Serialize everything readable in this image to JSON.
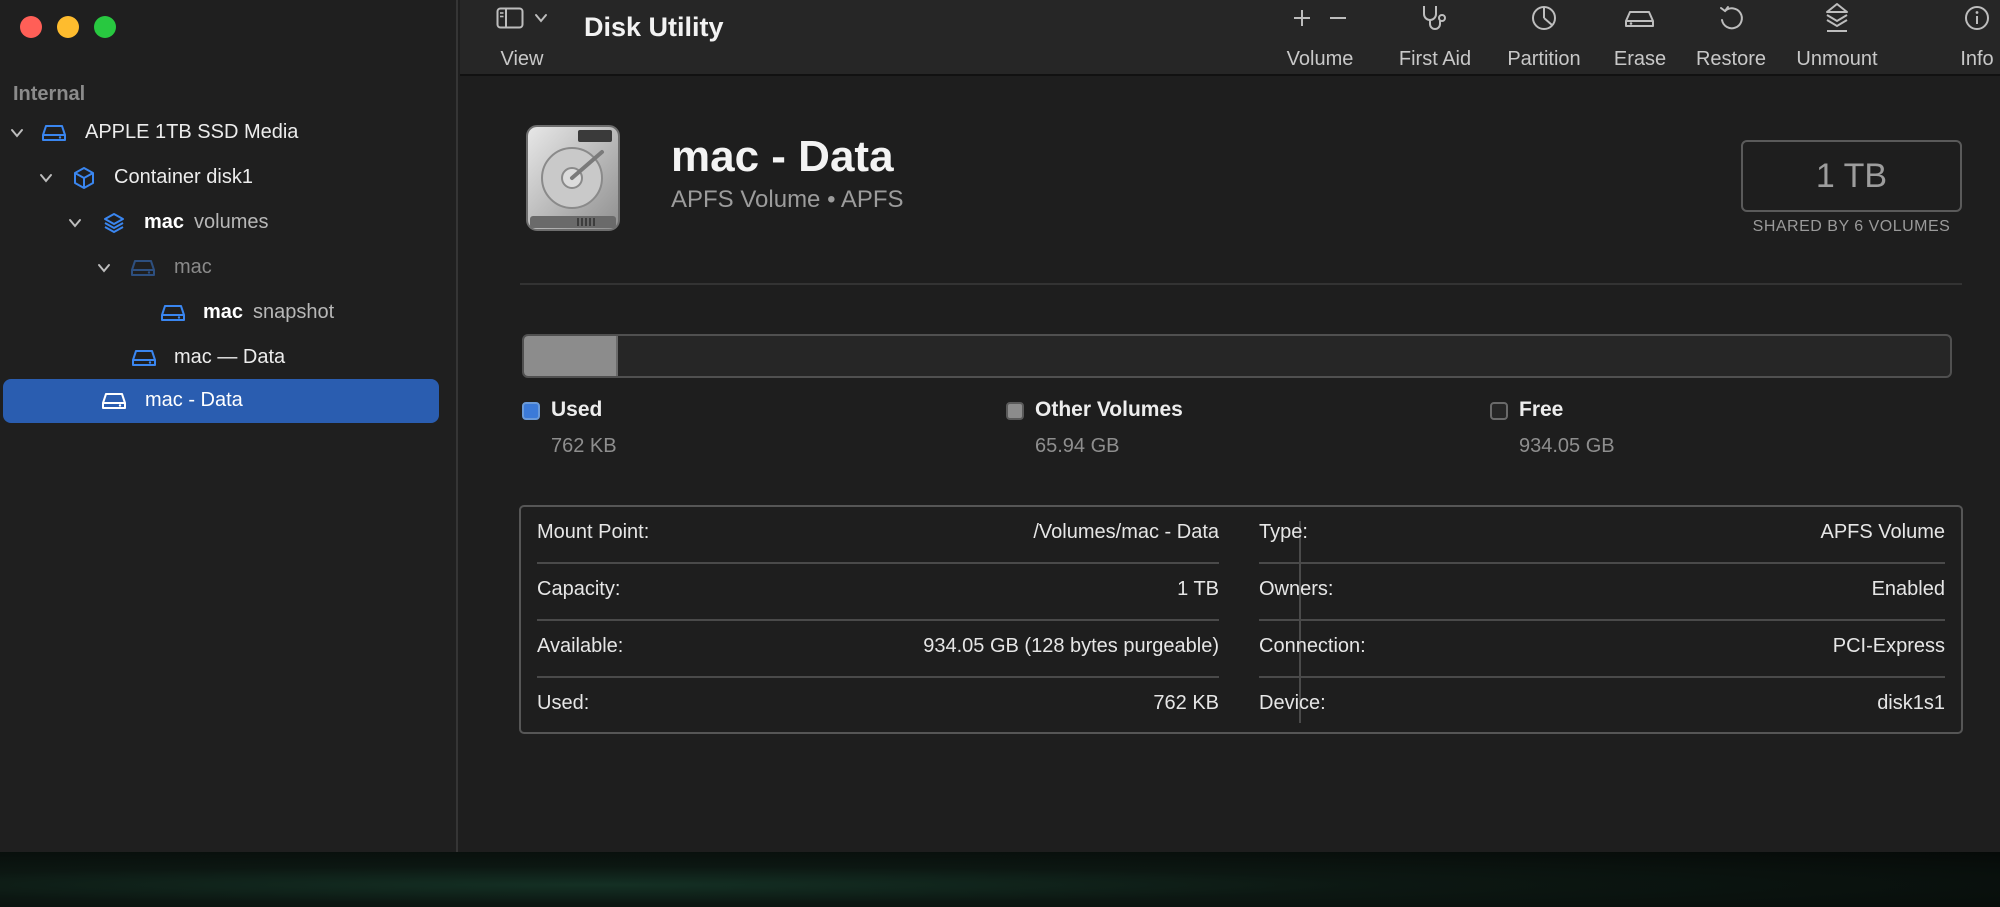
{
  "window": {
    "title": "Disk Utility"
  },
  "sidebar": {
    "section_label": "Internal",
    "items": [
      {
        "name": "APPLE 1TB SSD Media",
        "sub": ""
      },
      {
        "name": "Container disk1",
        "sub": ""
      },
      {
        "name": "mac",
        "sub": "volumes"
      },
      {
        "name": "mac",
        "sub": ""
      },
      {
        "name": "mac",
        "sub": "snapshot"
      },
      {
        "name": "mac — Data",
        "sub": ""
      },
      {
        "name": "mac - Data",
        "sub": ""
      }
    ]
  },
  "toolbar": {
    "view_label": "View",
    "volume_label": "Volume",
    "first_aid_label": "First Aid",
    "partition_label": "Partition",
    "erase_label": "Erase",
    "restore_label": "Restore",
    "unmount_label": "Unmount",
    "info_label": "Info"
  },
  "volume": {
    "name": "mac - Data",
    "subtitle": "APFS Volume • APFS",
    "capacity": "1 TB",
    "shared_note": "SHARED BY 6 VOLUMES"
  },
  "usage": {
    "used_fraction": 8e-07,
    "other_fraction": 0.066,
    "used_color": "#3b7ad8",
    "other_color": "#8c8c8c",
    "legend": [
      {
        "label": "Used",
        "value": "762 KB"
      },
      {
        "label": "Other Volumes",
        "value": "65.94 GB"
      },
      {
        "label": "Free",
        "value": "934.05 GB"
      }
    ]
  },
  "info": {
    "left": [
      {
        "key": "Mount Point:",
        "value": "/Volumes/mac - Data"
      },
      {
        "key": "Capacity:",
        "value": "1 TB"
      },
      {
        "key": "Available:",
        "value": "934.05 GB (128 bytes purgeable)"
      },
      {
        "key": "Used:",
        "value": "762 KB"
      }
    ],
    "right": [
      {
        "key": "Type:",
        "value": "APFS Volume"
      },
      {
        "key": "Owners:",
        "value": "Enabled"
      },
      {
        "key": "Connection:",
        "value": "PCI-Express"
      },
      {
        "key": "Device:",
        "value": "disk1s1"
      }
    ]
  },
  "icons": {
    "accent": "#3a86f0",
    "selection": "#2a5db0"
  }
}
